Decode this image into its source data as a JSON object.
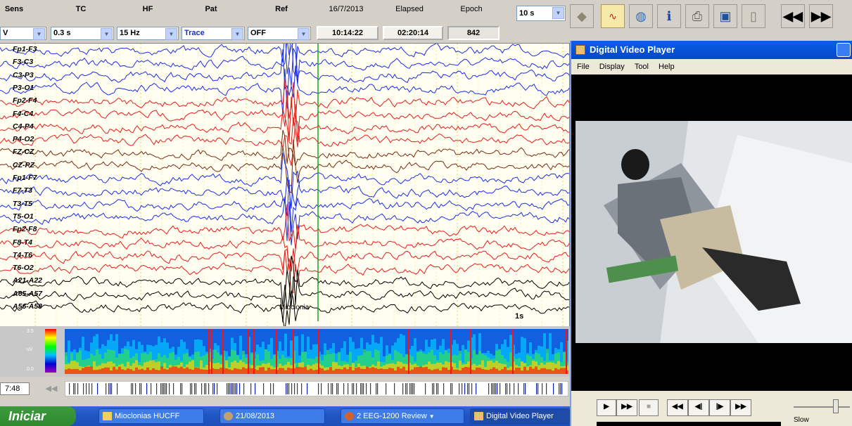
{
  "toolbar": {
    "headers": {
      "sens": "Sens",
      "tc": "TC",
      "hf": "HF",
      "pat": "Pat",
      "ref": "Ref",
      "date": "16/7/2013",
      "elapsed": "Elapsed",
      "epoch": "Epoch"
    },
    "sens_value": "V",
    "tc_value": "0.3 s",
    "hf_value": "15 Hz",
    "pat_value": "Trace",
    "ref_value": "OFF",
    "time_value": "10:14:22",
    "elapsed_value": "02:20:14",
    "epoch_value": "842",
    "timebase_value": "10 s"
  },
  "eeg": {
    "channels": [
      "Fp1-F3",
      "F3-C3",
      "C3-P3",
      "P3-O1",
      "Fp2-F4",
      "F4-C4",
      "C4-P4",
      "P4-O2",
      "FZ-CZ",
      "CZ-PZ",
      "Fp1-F7",
      "F7-T3",
      "T3-T5",
      "T5-O1",
      "Fp2-F8",
      "F8-T4",
      "T4-T6",
      "T6-O2",
      "A21-A22",
      "A65-A57",
      "A56-A58"
    ],
    "annotation": "Mioclonia",
    "scale_label": "1s",
    "spectro_ticks": [
      "3.5",
      "uV",
      "0.0"
    ],
    "time_left": "7:48"
  },
  "colors": {
    "blue": "#1c2ee8",
    "red": "#e81c1c",
    "brown": "#7a2b12",
    "black": "#000000"
  },
  "video_player": {
    "title": "Digital Video Player",
    "menu": [
      "File",
      "Display",
      "Tool",
      "Help"
    ],
    "speed_label": "Slow"
  },
  "taskbar": {
    "start_label": "Iniciar",
    "tasks": [
      "Mioclonias HUCFF",
      "21/08/2013",
      "2 EEG-1200 Review",
      "Digital Video Player"
    ]
  }
}
